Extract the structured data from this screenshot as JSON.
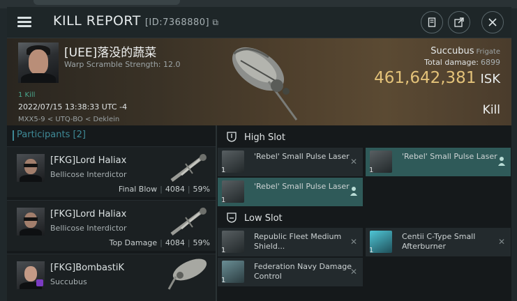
{
  "window": {
    "title": "KILL REPORT",
    "report_id": "[ID:7368880]"
  },
  "victim": {
    "name": "[UEE]落没的蔬菜",
    "warp_scramble": "Warp Scramble Strength: 12.0",
    "kills": "1 Kill",
    "datetime": "2022/07/15 13:38:33 UTC -4",
    "location": "MXX5-9 < UTQ-BO < Deklein"
  },
  "ship": {
    "name": "Succubus",
    "class": "Frigate",
    "total_damage_label": "Total damage:",
    "total_damage": "6899",
    "isk_value": "461,642,381",
    "currency": "ISK",
    "result": "Kill"
  },
  "participants": {
    "label": "Participants [2]",
    "rows": [
      {
        "name": "[FKG]Lord Haliax",
        "ship": "Bellicose Interdictor",
        "role": "Final Blow",
        "damage": "4084",
        "percent": "59%"
      },
      {
        "name": "[FKG]Lord Haliax",
        "ship": "Bellicose Interdictor",
        "role": "Top Damage",
        "damage": "4084",
        "percent": "59%"
      },
      {
        "name": "[FKG]BombastiK",
        "ship": "Succubus",
        "role": "",
        "damage": "",
        "percent": ""
      }
    ]
  },
  "high_slot": {
    "label": "High Slot",
    "modules": [
      {
        "name": "'Rebel' Small Pulse Laser",
        "qty": "1"
      },
      {
        "name": "'Rebel' Small Pulse Laser",
        "qty": "1"
      },
      {
        "name": "'Rebel' Small Pulse Laser",
        "qty": "1"
      }
    ]
  },
  "low_slot": {
    "label": "Low Slot",
    "modules": [
      {
        "name": "Republic Fleet Medium Shield...",
        "qty": "1"
      },
      {
        "name": "Centii C-Type Small Afterburner",
        "qty": "1"
      },
      {
        "name": "Federation Navy Damage Control",
        "qty": "1"
      }
    ]
  },
  "colors": {
    "accent": "#3f8a97",
    "isk": "#e3c279",
    "selected_module": "#2f5a59"
  },
  "icons": [
    "menu-icon",
    "copy-icon",
    "notes-icon",
    "export-icon",
    "close-icon",
    "shield-slot-icon",
    "remove-icon",
    "person-icon"
  ]
}
